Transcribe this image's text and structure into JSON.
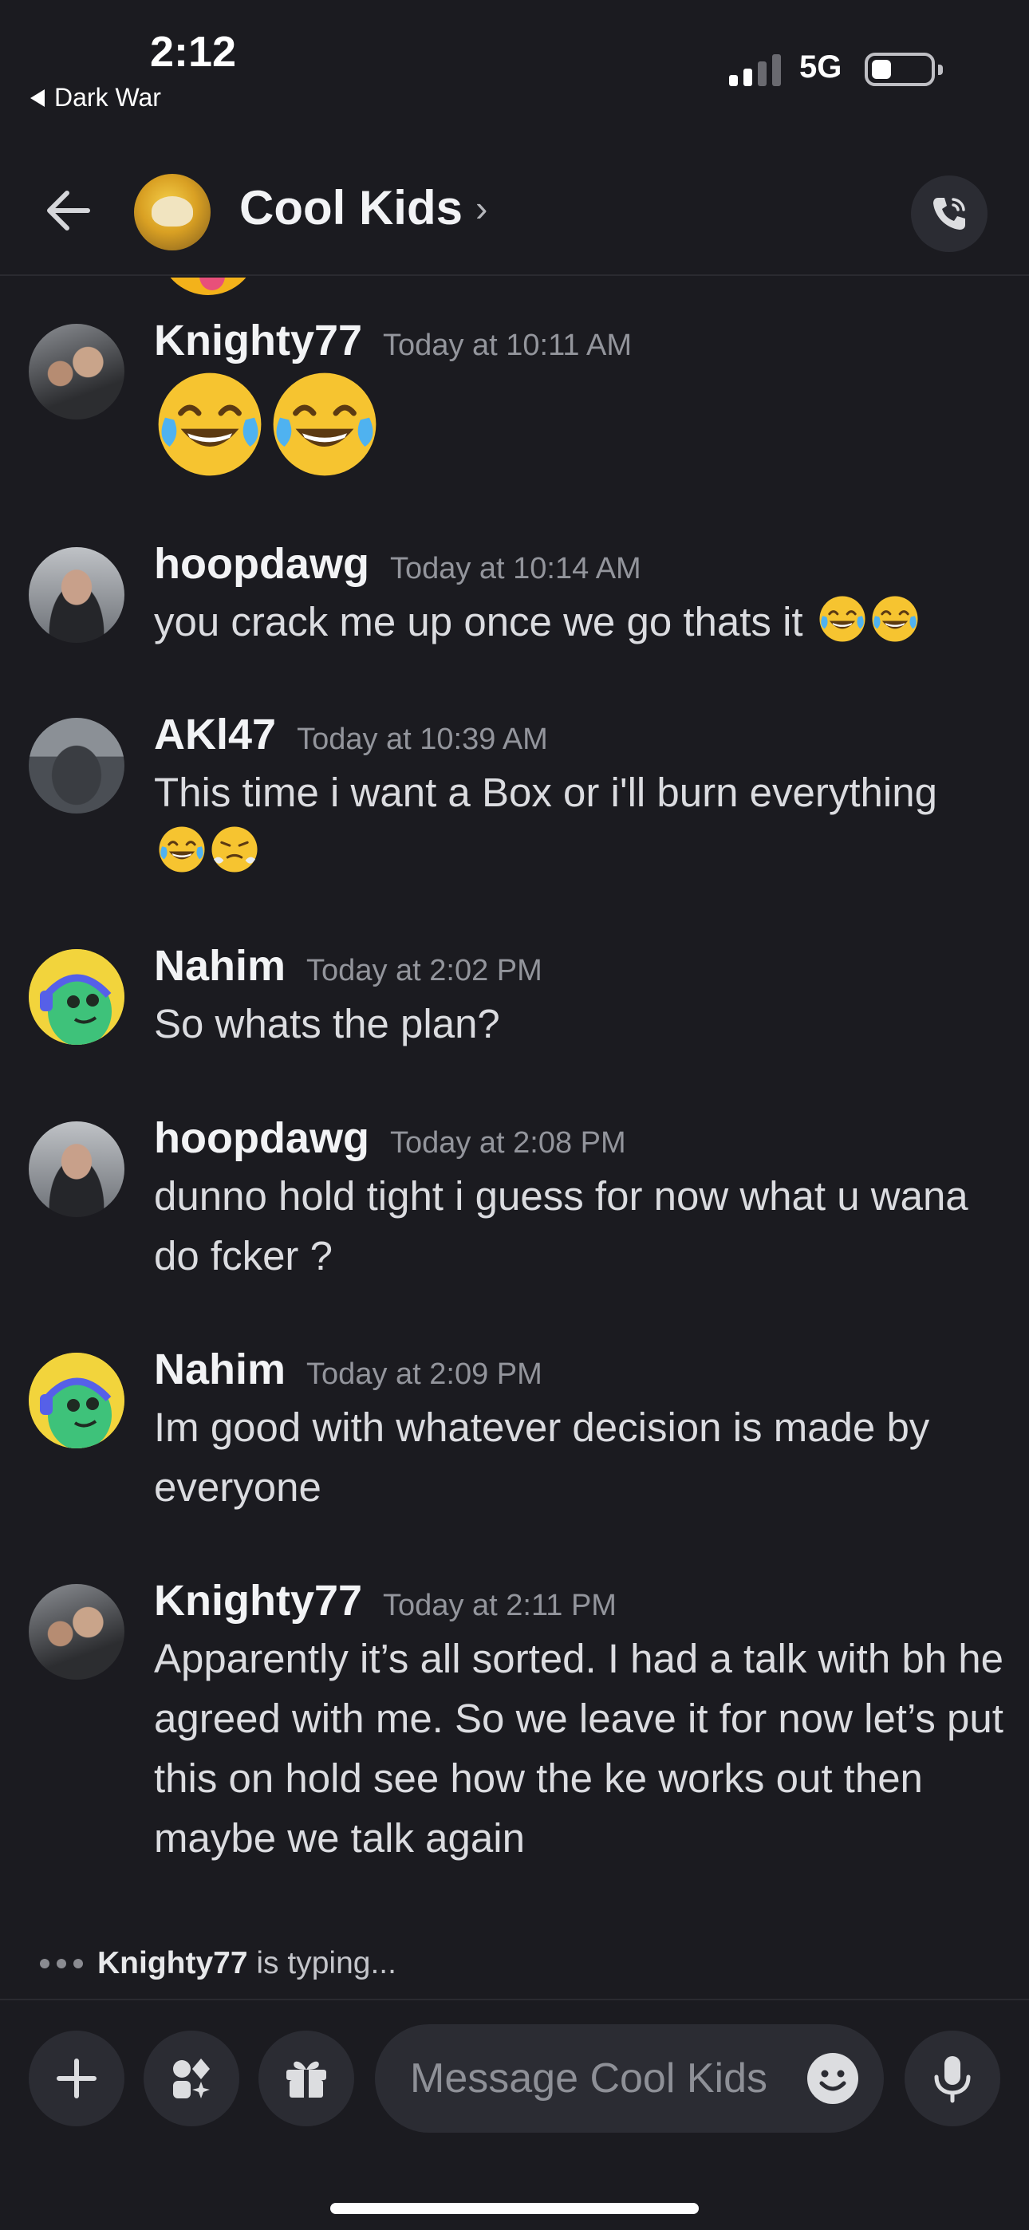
{
  "status_bar": {
    "time": "2:12",
    "back_app": "Dark War",
    "network": "5G"
  },
  "header": {
    "channel_name": "Cool Kids",
    "chevron": "›"
  },
  "messages": [
    {
      "username": "Knighty77",
      "timestamp": "Today at 10:11 AM",
      "text": "",
      "avatar": "photo-knighty",
      "emoji": [
        "joy",
        "joy"
      ]
    },
    {
      "username": "hoopdawg",
      "timestamp": "Today at 10:14 AM",
      "text": "you crack me up once we go thats it",
      "avatar": "photo-hoop",
      "emoji": [
        "joy",
        "joy"
      ]
    },
    {
      "username": "AKl47",
      "timestamp": "Today at 10:39 AM",
      "text": "This time i want a Box or i'll burn everything",
      "avatar": "photo-car",
      "emoji": [
        "joy",
        "triumph"
      ]
    },
    {
      "username": "Nahim",
      "timestamp": "Today at 2:02 PM",
      "text": "So whats the plan?",
      "avatar": "nahim"
    },
    {
      "username": "hoopdawg",
      "timestamp": "Today at 2:08 PM",
      "text": "dunno hold tight i guess for now what u wana do fcker ?",
      "avatar": "photo-hoop"
    },
    {
      "username": "Nahim",
      "timestamp": "Today at 2:09 PM",
      "text": "Im good with whatever decision is made by everyone",
      "avatar": "nahim"
    },
    {
      "username": "Knighty77",
      "timestamp": "Today at 2:11 PM",
      "text": "Apparently it’s all sorted. I had a talk with bh he agreed with me. So we leave it for now let’s put this on hold see how the ke works out then maybe we talk again",
      "avatar": "photo-knighty"
    }
  ],
  "typing": {
    "user": "Knighty77",
    "suffix": "is typing..."
  },
  "composer": {
    "placeholder": "Message Cool Kids"
  },
  "icons": [
    "back-arrow-icon",
    "phone-call-icon",
    "plus-icon",
    "apps-icon",
    "gift-icon",
    "emoji-icon",
    "microphone-icon"
  ],
  "colors": {
    "background": "#1b1b20",
    "surface": "#2b2c33",
    "username": "#f2f3f5",
    "timestamp": "#93959c",
    "text": "#dbdce0"
  }
}
